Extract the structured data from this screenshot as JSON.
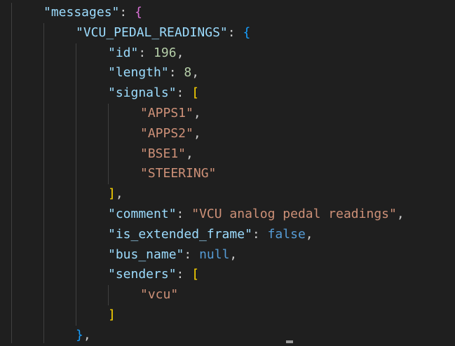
{
  "editor": {
    "language": "json",
    "theme_background": "#1f1f1f",
    "colors": {
      "key": "#9cdcfe",
      "string": "#ce9178",
      "number": "#b5cea8",
      "keyword": "#569cd6",
      "bracket_level1": "#da70d6",
      "bracket_level2": "#179fff",
      "bracket_level3": "#ffd700"
    },
    "lines": [
      {
        "indent": 1,
        "tokens": [
          {
            "t": "\"messages\"",
            "c": "tok-key"
          },
          {
            "t": ": ",
            "c": "tok-punc"
          },
          {
            "t": "{",
            "c": "br1"
          }
        ]
      },
      {
        "indent": 2,
        "tokens": [
          {
            "t": "\"VCU_PEDAL_READINGS\"",
            "c": "tok-key"
          },
          {
            "t": ": ",
            "c": "tok-punc"
          },
          {
            "t": "{",
            "c": "br2"
          }
        ]
      },
      {
        "indent": 3,
        "tokens": [
          {
            "t": "\"id\"",
            "c": "tok-key"
          },
          {
            "t": ": ",
            "c": "tok-punc"
          },
          {
            "t": "196",
            "c": "tok-num"
          },
          {
            "t": ",",
            "c": "tok-punc"
          }
        ]
      },
      {
        "indent": 3,
        "tokens": [
          {
            "t": "\"length\"",
            "c": "tok-key"
          },
          {
            "t": ": ",
            "c": "tok-punc"
          },
          {
            "t": "8",
            "c": "tok-num"
          },
          {
            "t": ",",
            "c": "tok-punc"
          }
        ]
      },
      {
        "indent": 3,
        "tokens": [
          {
            "t": "\"signals\"",
            "c": "tok-key"
          },
          {
            "t": ": ",
            "c": "tok-punc"
          },
          {
            "t": "[",
            "c": "br3"
          }
        ]
      },
      {
        "indent": 4,
        "tokens": [
          {
            "t": "\"APPS1\"",
            "c": "tok-str"
          },
          {
            "t": ",",
            "c": "tok-punc"
          }
        ]
      },
      {
        "indent": 4,
        "tokens": [
          {
            "t": "\"APPS2\"",
            "c": "tok-str"
          },
          {
            "t": ",",
            "c": "tok-punc"
          }
        ]
      },
      {
        "indent": 4,
        "tokens": [
          {
            "t": "\"BSE1\"",
            "c": "tok-str"
          },
          {
            "t": ",",
            "c": "tok-punc"
          }
        ]
      },
      {
        "indent": 4,
        "tokens": [
          {
            "t": "\"STEERING\"",
            "c": "tok-str"
          }
        ]
      },
      {
        "indent": 3,
        "tokens": [
          {
            "t": "]",
            "c": "br3"
          },
          {
            "t": ",",
            "c": "tok-punc"
          }
        ]
      },
      {
        "indent": 3,
        "tokens": [
          {
            "t": "\"comment\"",
            "c": "tok-key"
          },
          {
            "t": ": ",
            "c": "tok-punc"
          },
          {
            "t": "\"VCU analog pedal readings\"",
            "c": "tok-str"
          },
          {
            "t": ",",
            "c": "tok-punc"
          }
        ]
      },
      {
        "indent": 3,
        "tokens": [
          {
            "t": "\"is_extended_frame\"",
            "c": "tok-key"
          },
          {
            "t": ": ",
            "c": "tok-punc"
          },
          {
            "t": "false",
            "c": "tok-kw"
          },
          {
            "t": ",",
            "c": "tok-punc"
          }
        ]
      },
      {
        "indent": 3,
        "tokens": [
          {
            "t": "\"bus_name\"",
            "c": "tok-key"
          },
          {
            "t": ": ",
            "c": "tok-punc"
          },
          {
            "t": "null",
            "c": "tok-kw"
          },
          {
            "t": ",",
            "c": "tok-punc"
          }
        ]
      },
      {
        "indent": 3,
        "tokens": [
          {
            "t": "\"senders\"",
            "c": "tok-key"
          },
          {
            "t": ": ",
            "c": "tok-punc"
          },
          {
            "t": "[",
            "c": "br3"
          }
        ]
      },
      {
        "indent": 4,
        "tokens": [
          {
            "t": "\"vcu\"",
            "c": "tok-str"
          }
        ]
      },
      {
        "indent": 3,
        "tokens": [
          {
            "t": "]",
            "c": "br3"
          }
        ]
      },
      {
        "indent": 2,
        "tokens": [
          {
            "t": "}",
            "c": "br2"
          },
          {
            "t": ",",
            "c": "tok-punc"
          }
        ]
      }
    ]
  }
}
